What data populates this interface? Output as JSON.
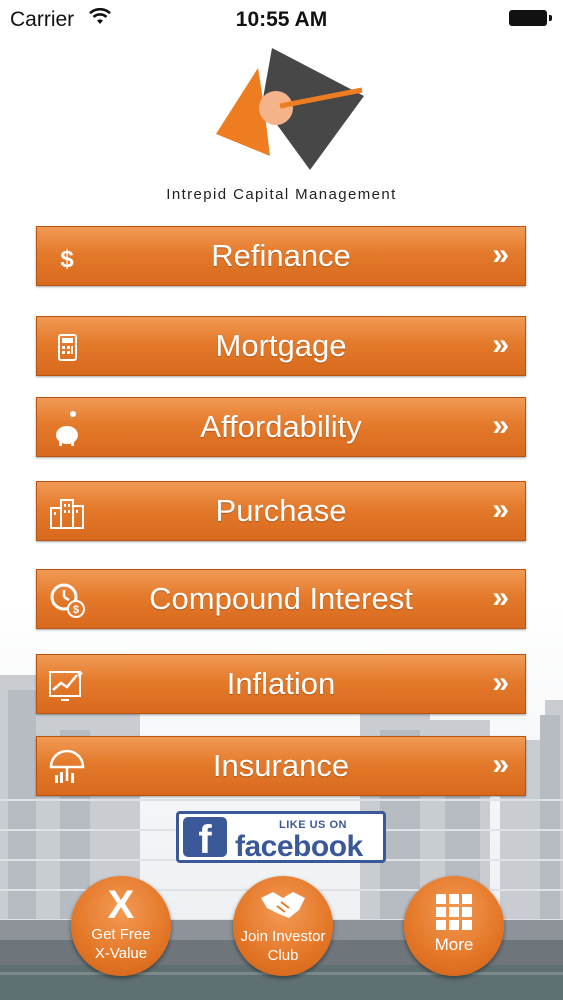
{
  "status_bar": {
    "carrier": "Carrier",
    "time": "10:55 AM"
  },
  "brand": {
    "name": "Intrepid Capital Management"
  },
  "menu": [
    {
      "label": "Refinance",
      "icon": "dollar-icon"
    },
    {
      "label": "Mortgage",
      "icon": "calculator-icon"
    },
    {
      "label": "Affordability",
      "icon": "piggy-bank-icon"
    },
    {
      "label": "Purchase",
      "icon": "buildings-icon"
    },
    {
      "label": "Compound Interest",
      "icon": "clock-dollar-icon"
    },
    {
      "label": "Inflation",
      "icon": "chart-trend-icon"
    },
    {
      "label": "Insurance",
      "icon": "umbrella-icon"
    }
  ],
  "chevron": "»",
  "facebook": {
    "like_text": "LIKE US ON",
    "word": "facebook",
    "letter": "f"
  },
  "actions": {
    "xvalue": {
      "line1": "Get Free",
      "line2": "X-Value",
      "glyph": "X"
    },
    "investor": {
      "line1": "Join Investor",
      "line2": "Club"
    },
    "more": {
      "label": "More"
    }
  },
  "colors": {
    "accent": "#e47a2b",
    "dark_logo": "#444444",
    "facebook": "#3b5998"
  }
}
